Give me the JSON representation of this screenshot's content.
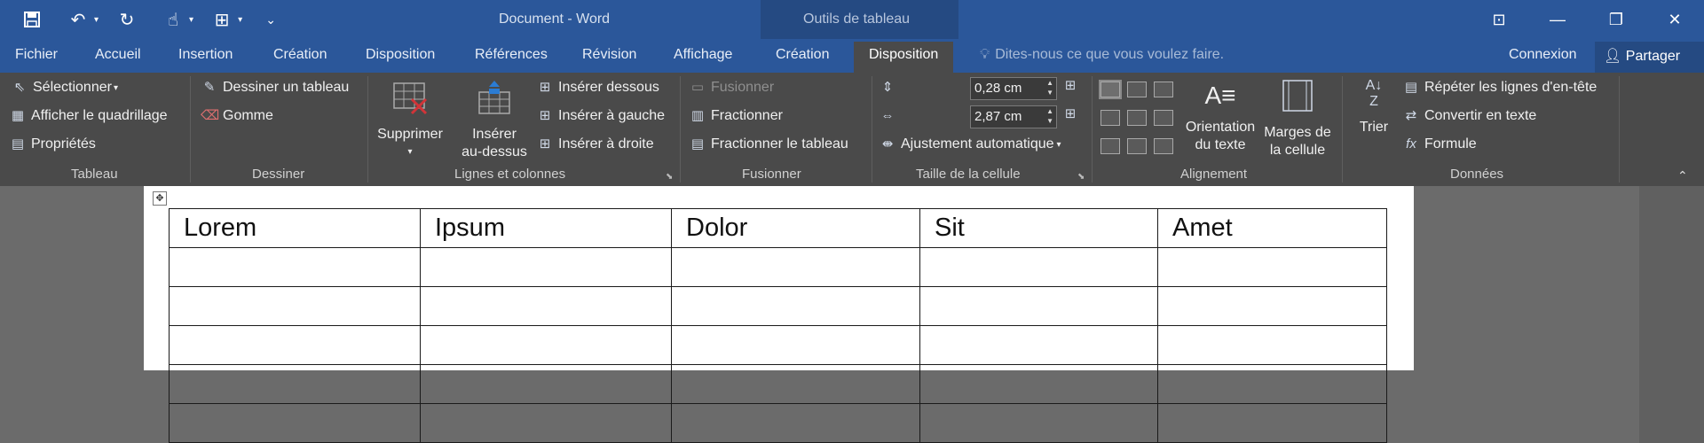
{
  "titlebar": {
    "doc_title": "Document - Word",
    "tools_title": "Outils de tableau",
    "qat_icons": [
      "save-icon",
      "undo-icon",
      "redo-icon",
      "touch-mode-icon",
      "table-icon",
      "customize-icon"
    ]
  },
  "tabs": [
    "Fichier",
    "Accueil",
    "Insertion",
    "Création",
    "Disposition",
    "Références",
    "Révision",
    "Affichage",
    "Création",
    "Disposition"
  ],
  "active_tab": "Disposition",
  "tellme": "Dites-nous ce que vous voulez faire.",
  "account": {
    "connexion": "Connexion",
    "share": "Partager"
  },
  "ribbon": {
    "tableau": {
      "label": "Tableau",
      "select": "Sélectionner",
      "gridlines": "Afficher le quadrillage",
      "properties": "Propriétés"
    },
    "dessiner": {
      "label": "Dessiner",
      "draw_table": "Dessiner un tableau",
      "eraser": "Gomme"
    },
    "lignes": {
      "label": "Lignes et colonnes",
      "delete": "Supprimer",
      "insert_above_1": "Insérer",
      "insert_above_2": "au-dessus",
      "insert_below": "Insérer dessous",
      "insert_left": "Insérer à gauche",
      "insert_right": "Insérer à droite"
    },
    "fusionner": {
      "label": "Fusionner",
      "merge": "Fusionner",
      "split": "Fractionner",
      "split_table": "Fractionner le tableau"
    },
    "taille": {
      "label": "Taille de la cellule",
      "height": "0,28 cm",
      "width": "2,87 cm",
      "autofit": "Ajustement automatique"
    },
    "alignement": {
      "label": "Alignement",
      "orientation_1": "Orientation",
      "orientation_2": "du texte",
      "margins_1": "Marges de",
      "margins_2": "la cellule"
    },
    "donnees": {
      "label": "Données",
      "sort": "Trier",
      "repeat_header": "Répéter les lignes d'en-tête",
      "convert": "Convertir en texte",
      "formula": "Formule"
    }
  },
  "table": {
    "headers": [
      "Lorem",
      "Ipsum",
      "Dolor",
      "Sit",
      "Amet"
    ],
    "empty_rows": 5
  }
}
